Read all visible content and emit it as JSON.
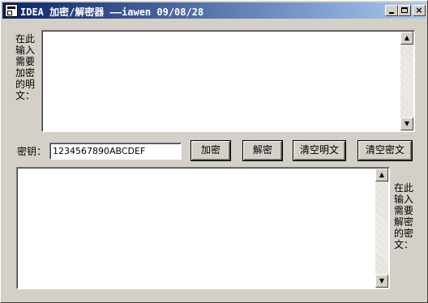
{
  "window": {
    "title": "IDEA 加密/解密器 ——iawen 09/08/28",
    "minimize_glyph": "_",
    "maximize_glyph": "□",
    "close_glyph": "×"
  },
  "plaintext": {
    "label": "在此输入需要加密的明文：",
    "value": ""
  },
  "ciphertext": {
    "label": "在此输入需要解密的密文：",
    "value": ""
  },
  "key": {
    "label": "密钥：",
    "value": "1234567890ABCDEF"
  },
  "buttons": {
    "encrypt": "加密",
    "decrypt": "解密",
    "clear_plain": "清空明文",
    "clear_cipher": "清空密文"
  },
  "scroll": {
    "up_glyph": "▲",
    "down_glyph": "▼"
  }
}
